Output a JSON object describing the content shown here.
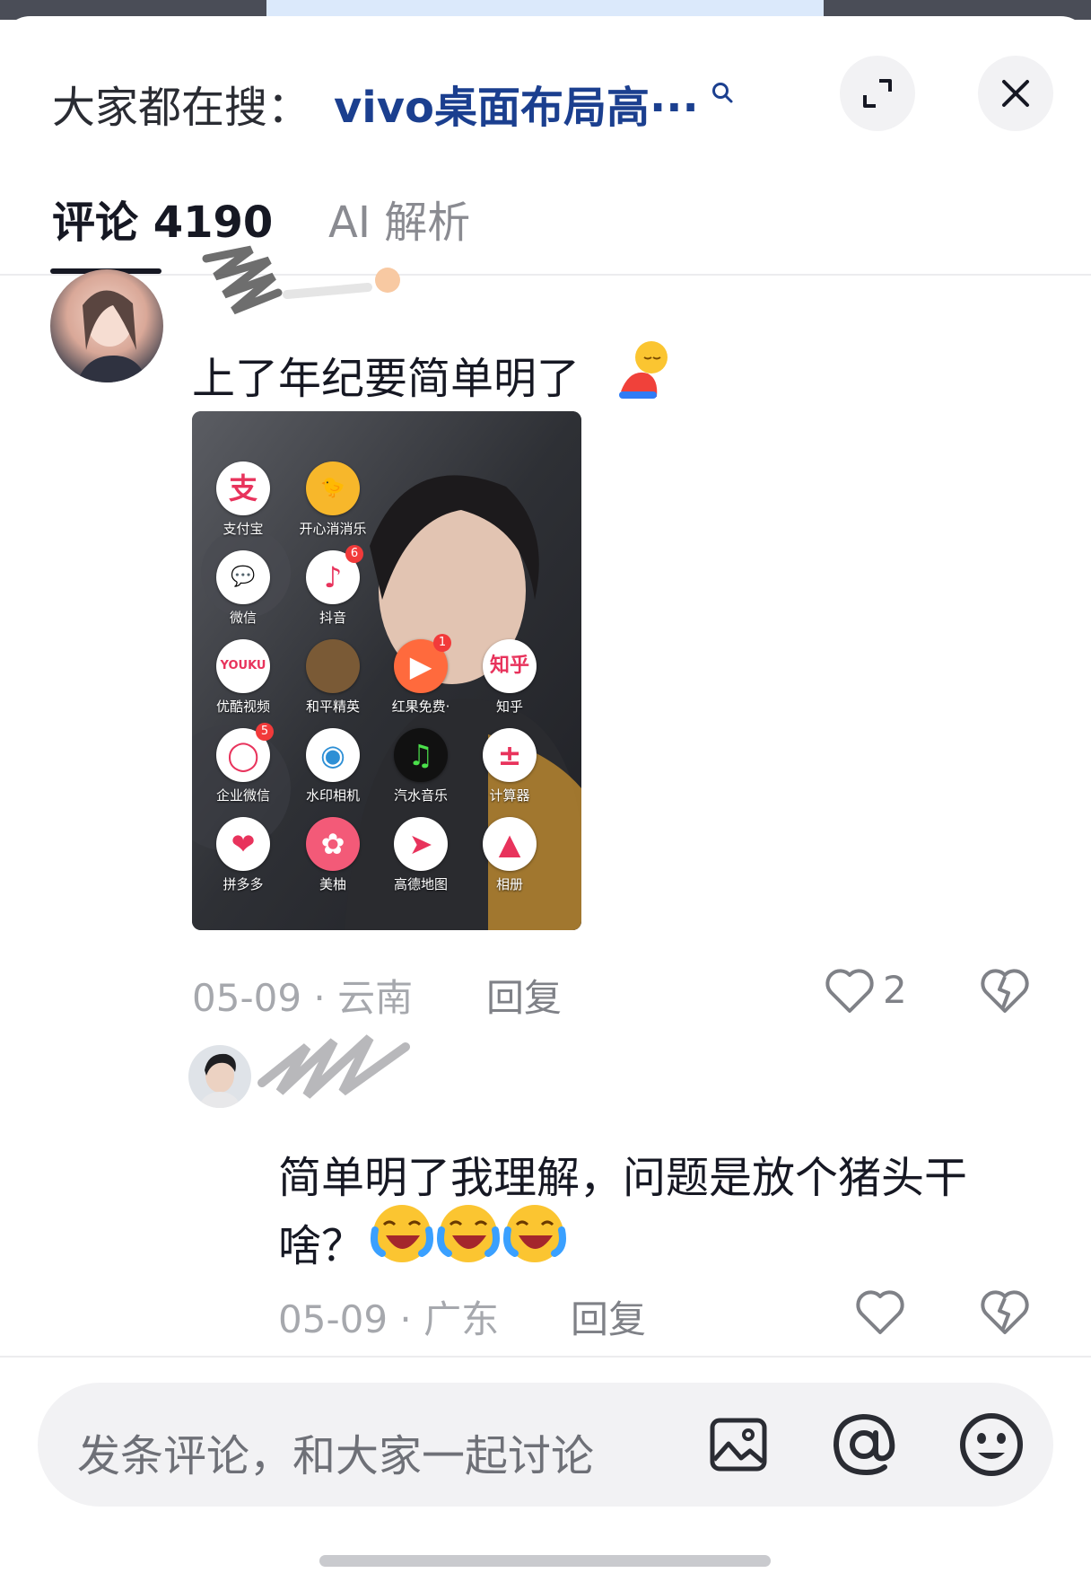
{
  "header": {
    "prefix": "大家都在搜：",
    "query": "vivo桌面布局高···",
    "icons": [
      "search-icon",
      "expand-icon",
      "close-icon"
    ]
  },
  "tabs": [
    {
      "label": "评论 4190",
      "active": true
    },
    {
      "label": "AI 解析",
      "active": false
    }
  ],
  "comments": [
    {
      "text": "上了年纪要简单明了",
      "date_location": "05-09 · 云南",
      "reply_label": "回复",
      "likes": "2",
      "image_apps": [
        {
          "label": "支付宝",
          "color": "#ffffff",
          "glyph": "支",
          "glyph_color": "#e8335c"
        },
        {
          "label": "开心消消乐",
          "color": "#f7b72b",
          "glyph": "🐤",
          "glyph_color": "#000000"
        },
        {
          "label": "微信",
          "color": "#ffffff",
          "glyph": "💬",
          "glyph_color": "#e8335c"
        },
        {
          "label": "抖音",
          "color": "#ffffff",
          "glyph": "♪",
          "glyph_color": "#e8335c",
          "badge": "6"
        },
        {
          "label": "优酷视频",
          "color": "#ffffff",
          "glyph": "YOUKU",
          "glyph_color": "#e8335c"
        },
        {
          "label": "和平精英",
          "color": "#7a5a36",
          "glyph": "",
          "glyph_color": "#ffffff"
        },
        {
          "label": "红果免费·",
          "color": "#ff6a3d",
          "glyph": "▶",
          "glyph_color": "#ffffff",
          "badge": "1"
        },
        {
          "label": "知乎",
          "color": "#ffffff",
          "glyph": "知乎",
          "glyph_color": "#e8335c"
        },
        {
          "label": "企业微信",
          "color": "#ffffff",
          "glyph": "◯",
          "glyph_color": "#e8335c",
          "badge": "5"
        },
        {
          "label": "水印相机",
          "color": "#ffffff",
          "glyph": "◉",
          "glyph_color": "#2d8fd5"
        },
        {
          "label": "汽水音乐",
          "color": "#111111",
          "glyph": "♫",
          "glyph_color": "#4be04b"
        },
        {
          "label": "计算器",
          "color": "#ffffff",
          "glyph": "±",
          "glyph_color": "#e8335c"
        },
        {
          "label": "拼多多",
          "color": "#ffffff",
          "glyph": "❤",
          "glyph_color": "#e8335c"
        },
        {
          "label": "美柚",
          "color": "#f35a78",
          "glyph": "✿",
          "glyph_color": "#ffffff"
        },
        {
          "label": "高德地图",
          "color": "#ffffff",
          "glyph": "➤",
          "glyph_color": "#e8335c"
        },
        {
          "label": "相册",
          "color": "#ffffff",
          "glyph": "▲",
          "glyph_color": "#e8335c"
        }
      ]
    },
    {
      "text_line1": "简单明了我理解，问题是放个猪头干",
      "text_line2": "啥？",
      "date_location": "05-09 · 广东",
      "reply_label": "回复"
    }
  ],
  "input": {
    "placeholder": "发条评论，和大家一起讨论",
    "icons": [
      "image-icon",
      "at-icon",
      "emoji-icon"
    ]
  },
  "colors": {
    "query_blue": "#1b3f8f",
    "text_primary": "#161823",
    "text_secondary": "#a6a8ad",
    "badge_red": "#f23a3a"
  }
}
